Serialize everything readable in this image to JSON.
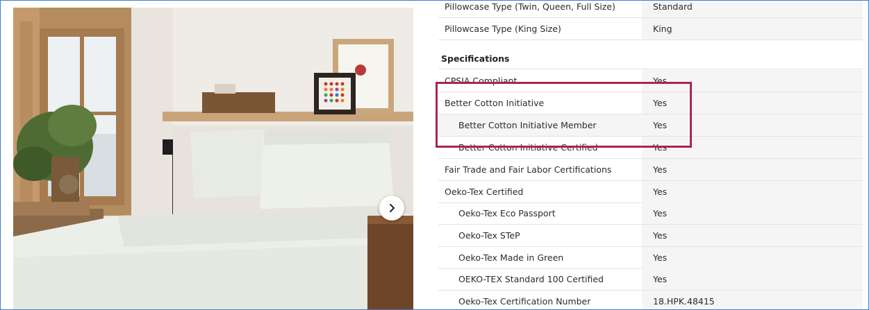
{
  "photo": {
    "alt_icon": "product-photo-bed-with-white-sheets",
    "next_icon": "chevron-right-icon"
  },
  "specs": {
    "top_rows": [
      {
        "label": "Pillowcase Type (Twin, Queen, Full Size)",
        "value": "Standard"
      },
      {
        "label": "Pillowcase Type (King Size)",
        "value": "King"
      }
    ],
    "section_title": "Specifications",
    "rows": [
      {
        "label": "CPSIA Compliant",
        "value": "Yes"
      },
      {
        "label": "Better Cotton Initiative",
        "value": "Yes"
      },
      {
        "label": "Better Cotton Initiative Member",
        "value": "Yes"
      },
      {
        "label": "Better Cotton Initiative Certified",
        "value": "Yes"
      },
      {
        "label": "Fair Trade and Fair Labor Certifications",
        "value": "Yes"
      },
      {
        "label": "Oeko-Tex Certified",
        "value": "Yes"
      },
      {
        "label": "Oeko-Tex Eco Passport",
        "value": "Yes"
      },
      {
        "label": "Oeko-Tex STeP",
        "value": "Yes"
      },
      {
        "label": "Oeko-Tex Made in Green",
        "value": "Yes"
      },
      {
        "label": "OEKO-TEX Standard 100 Certified",
        "value": "Yes"
      },
      {
        "label": "Oeko-Tex Certification Number",
        "value": "18.HPK.48415"
      }
    ]
  },
  "colors": {
    "highlight": "#a8264f",
    "frame_border": "#3e7fc9",
    "value_bg": "#f5f5f5"
  }
}
